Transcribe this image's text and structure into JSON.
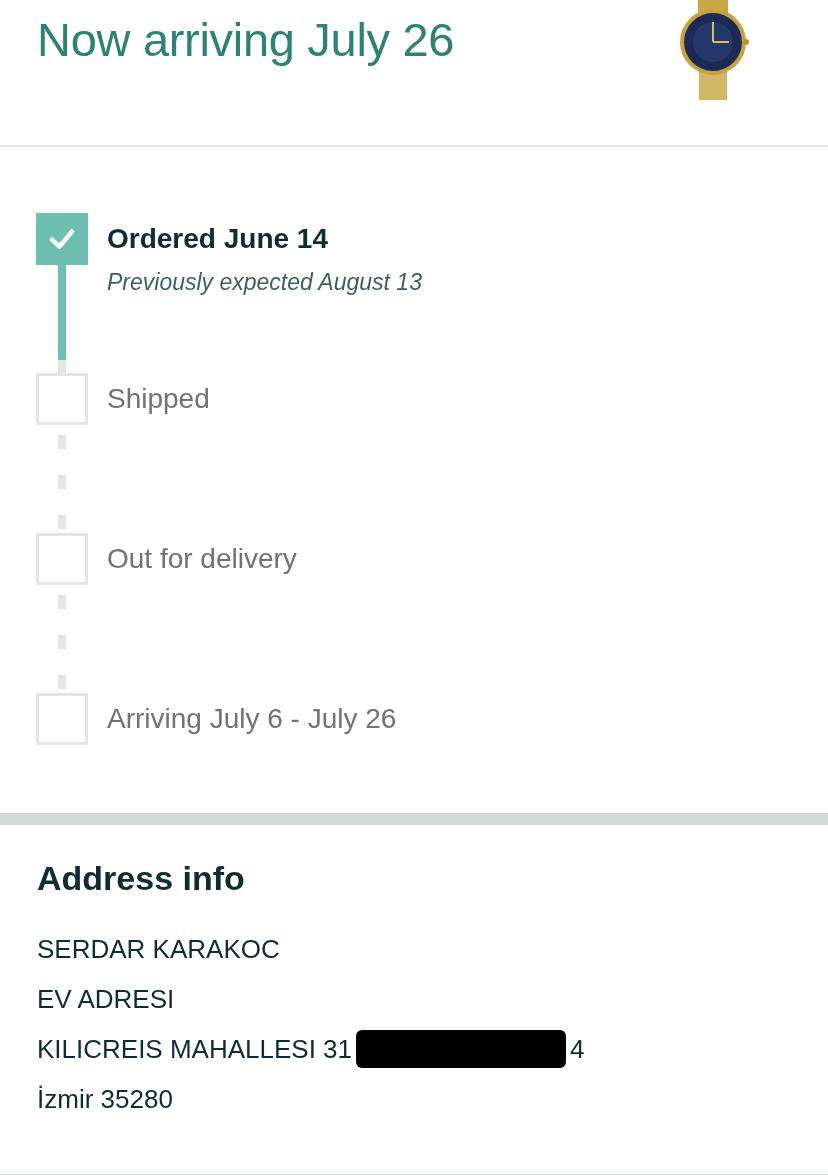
{
  "header": {
    "title": "Now arriving July 26"
  },
  "steps": [
    {
      "label": "Ordered June 14",
      "note": "Previously expected August 13",
      "checked": true
    },
    {
      "label": "Shipped",
      "checked": false
    },
    {
      "label": "Out for delivery",
      "checked": false
    },
    {
      "label": "Arriving July 6 - July 26",
      "checked": false
    }
  ],
  "address": {
    "heading": "Address info",
    "lines": [
      {
        "kind": "plain",
        "text": "SERDAR KARAKOC"
      },
      {
        "kind": "plain",
        "text": "EV ADRESI"
      },
      {
        "kind": "redacted",
        "text": "KILICREIS MAHALLESI 31",
        "tail": "4"
      },
      {
        "kind": "plain",
        "text": "İzmir 35280"
      }
    ]
  }
}
